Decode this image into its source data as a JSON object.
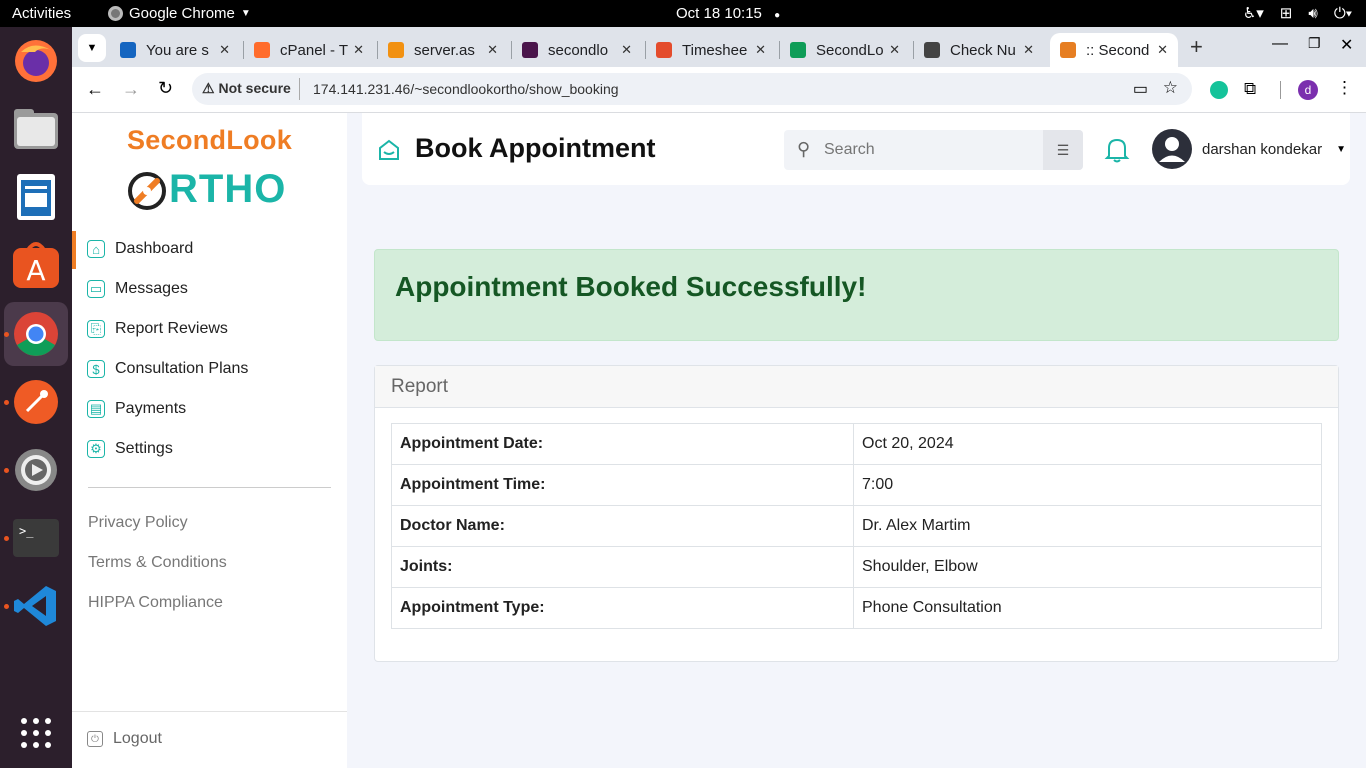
{
  "os": {
    "activities": "Activities",
    "app_name": "Google Chrome",
    "clock": "Oct 18  10:15"
  },
  "browser": {
    "tabs": [
      {
        "title": "You are s",
        "favicon_color": "#1565c0"
      },
      {
        "title": "cPanel - T",
        "favicon_color": "#ff6c2c"
      },
      {
        "title": "server.as",
        "favicon_color": "#f29111"
      },
      {
        "title": "secondlo",
        "favicon_color": "#4a154b"
      },
      {
        "title": "Timeshee",
        "favicon_color": "#e44c2c"
      },
      {
        "title": "SecondLo",
        "favicon_color": "#0f9d58"
      },
      {
        "title": "Check Nu",
        "favicon_color": "#444444"
      },
      {
        "title": ":: Second",
        "favicon_color": "#e67e22"
      }
    ],
    "security_label": "Not secure",
    "url": "174.141.231.46/~secondlookortho/show_booking",
    "profile_initial": "d"
  },
  "brand": {
    "line1": "SecondLook",
    "line2": "RTHO",
    "orange": "#ef7d24",
    "teal": "#1bb5a8"
  },
  "sidebar": {
    "items": [
      {
        "label": "Dashboard",
        "icon": "home-icon"
      },
      {
        "label": "Messages",
        "icon": "message-icon"
      },
      {
        "label": "Report Reviews",
        "icon": "report-icon"
      },
      {
        "label": "Consultation Plans",
        "icon": "plan-icon"
      },
      {
        "label": "Payments",
        "icon": "payment-icon"
      },
      {
        "label": "Settings",
        "icon": "settings-icon"
      }
    ],
    "footer_links": [
      "Privacy Policy",
      "Terms & Conditions",
      "HIPPA Compliance"
    ],
    "logout": "Logout"
  },
  "header": {
    "title": "Book Appointment",
    "search_placeholder": "Search",
    "user_name": "darshan kondekar"
  },
  "alert": {
    "message": "Appointment Booked Successfully!",
    "color": "#155724"
  },
  "report": {
    "title": "Report",
    "rows": [
      {
        "label": "Appointment Date:",
        "value": "Oct 20, 2024"
      },
      {
        "label": "Appointment Time:",
        "value": "7:00"
      },
      {
        "label": "Doctor Name:",
        "value": "Dr. Alex Martim"
      },
      {
        "label": "Joints:",
        "value": "Shoulder, Elbow"
      },
      {
        "label": "Appointment Type:",
        "value": "Phone Consultation"
      }
    ]
  }
}
